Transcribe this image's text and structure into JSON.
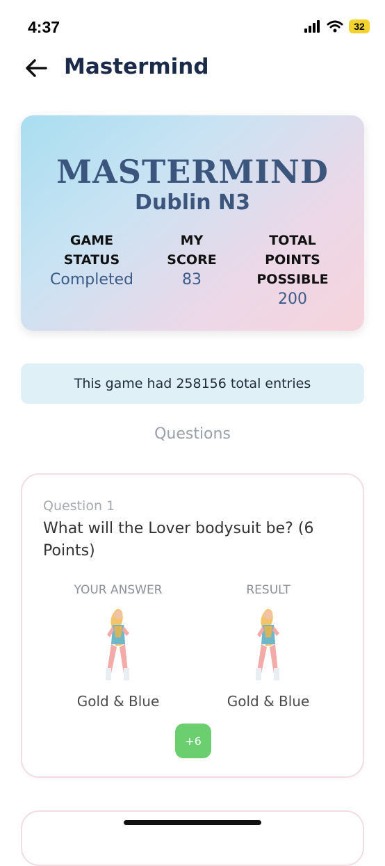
{
  "status_bar": {
    "time": "4:37",
    "battery": "32"
  },
  "header": {
    "title": "Mastermind"
  },
  "hero": {
    "logo": "MASTERMIND",
    "subtitle": "Dublin N3",
    "stats": [
      {
        "label": "GAME\nSTATUS",
        "value": "Completed"
      },
      {
        "label": "MY\nSCORE",
        "value": "83"
      },
      {
        "label": "TOTAL\nPOINTS\nPOSSIBLE",
        "value": "200"
      }
    ]
  },
  "entries_banner": "This game had 258156 total entries",
  "section_title": "Questions",
  "question": {
    "number": "Question 1",
    "text": "What will the Lover bodysuit be? (6 Points)",
    "your_answer_header": "YOUR ANSWER",
    "result_header": "RESULT",
    "your_answer": "Gold & Blue",
    "result": "Gold & Blue",
    "points": "+6"
  },
  "colors": {
    "accent": "#3b557d",
    "success": "#6ccf6f",
    "banner": "#dff0f7"
  }
}
